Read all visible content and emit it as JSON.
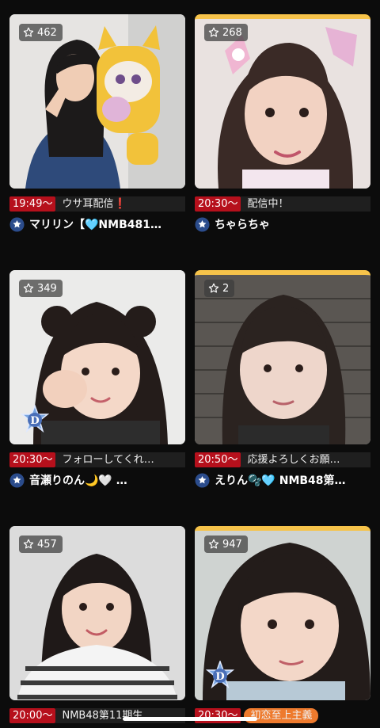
{
  "cards": [
    {
      "viewers": "462",
      "time": "19:49〜",
      "caption": "ウサ耳配信❗",
      "name": "マリリン【🩵NMB481…",
      "photo": "photo-girl-with-plush"
    },
    {
      "viewers": "268",
      "time": "20:30〜",
      "caption": "配信中！",
      "name": "ちゃらちゃ",
      "photo": "photo-girl-with-bow"
    },
    {
      "viewers": "349",
      "time": "20:30〜",
      "caption": "フォローしてくれ…",
      "name": "音瀬りのん🌙🤍 …",
      "photo": "photo-girl-fist-pose"
    },
    {
      "viewers": "2",
      "time": "20:50〜",
      "caption": "応援よろしくお願…",
      "name": "えりん🫧🩵 NMB48第…",
      "photo": "photo-girl-brick-wall"
    },
    {
      "viewers": "457",
      "time": "20:00〜",
      "caption": "NMB48第11期生",
      "name": "",
      "photo": "photo-girl-striped-shirt"
    },
    {
      "viewers": "947",
      "time": "20:30〜",
      "caption": "初恋至上主義",
      "name": "",
      "photo": "photo-girl-closeup"
    }
  ],
  "colors": {
    "background": "#0c0c0c",
    "time_badge": "#b6101c",
    "caption_bg": "#1f1f1f",
    "gold_border": "#f6c34a",
    "orange_tag": "#ee7a2d",
    "official_badge": "#2b4c8c"
  },
  "icons": {
    "viewer": "star-outline-icon",
    "official": "blue-star-badge-icon",
    "tier": "d-rank-badge-icon"
  }
}
